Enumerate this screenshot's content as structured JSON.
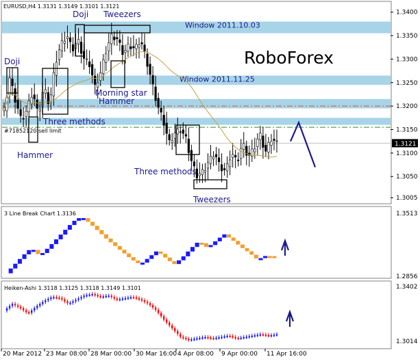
{
  "colors": {
    "window_zone": "#a8d4e8",
    "candle": "#000000",
    "bull": "#1a1aff",
    "bear_lb": "#f0a030",
    "bear_ha": "#ff0000",
    "logo": "#d2691e",
    "label": "#1a1a8c",
    "dash_red": "#e05020",
    "dash_green": "#2a8a2a",
    "ma": "#c8a040",
    "price_box": "#000000",
    "arrow": "#1a1a8c"
  },
  "main": {
    "title": "EURUSD,H4  1.3131 1.3149 1.3101 1.3121",
    "logo": "RoboForex",
    "current_price": "1.3121",
    "sell_limit": "#71852120 sell limit",
    "windows": [
      "Window 2011.10.03",
      "Window 2011.11.25"
    ],
    "pattern_labels": [
      "Doji",
      "Tweezers",
      "Doji",
      "Morning star",
      "Hammer",
      "Three methods",
      "Hammer",
      "Three methods",
      "Tweezers"
    ],
    "y_ticks": [
      "1.3400",
      "1.3350",
      "1.3300",
      "1.3250",
      "1.3200",
      "1.3150",
      "1.3100",
      "1.3050",
      "1.3005"
    ]
  },
  "line_break": {
    "title": "3 Line Break Chart 1.3136",
    "y_ticks": [
      "1.3513",
      "1.2856"
    ]
  },
  "heiken_ashi": {
    "title": "Heiken-Ashi 1.3118 1.3125 1.3118 1.3149 1.3101",
    "y_ticks": [
      "1.3402",
      "1.3014"
    ]
  },
  "x_ticks": [
    "20 Mar 2012",
    "23 Mar 08:00",
    "28 Mar 00:00",
    "30 Mar 16:00",
    "4 Apr 08:00",
    "9 Apr 00:00",
    "11 Apr 16:00"
  ],
  "chart_data": [
    {
      "type": "candlestick",
      "title": "EURUSD,H4  1.3131 1.3149 1.3101 1.3121",
      "symbol": "EURUSD",
      "timeframe": "H4",
      "last": {
        "open": 1.3131,
        "high": 1.3149,
        "low": 1.3101,
        "close": 1.3121
      },
      "ylim": [
        1.2995,
        1.342
      ],
      "x": [
        "20 Mar 2012",
        "23 Mar 08:00",
        "28 Mar 00:00",
        "30 Mar 16:00",
        "4 Apr 08:00",
        "9 Apr 00:00",
        "11 Apr 16:00"
      ],
      "close_path": [
        1.319,
        1.326,
        1.321,
        1.317,
        1.319,
        1.323,
        1.318,
        1.324,
        1.32,
        1.329,
        1.333,
        1.335,
        1.332,
        1.334,
        1.33,
        1.329,
        1.324,
        1.327,
        1.332,
        1.335,
        1.334,
        1.331,
        1.333,
        1.332,
        1.334,
        1.33,
        1.325,
        1.32,
        1.317,
        1.312,
        1.314,
        1.315,
        1.313,
        1.308,
        1.305,
        1.306,
        1.308,
        1.31,
        1.307,
        1.306,
        1.31,
        1.308,
        1.312,
        1.309,
        1.311,
        1.314,
        1.31,
        1.313,
        1.312
      ],
      "zones": [
        {
          "label": "Window 2011.10.03",
          "low": 1.3355,
          "high": 1.338
        },
        {
          "label": "Window 2011.11.25",
          "low": 1.3245,
          "high": 1.3265
        },
        {
          "label": "",
          "low": 1.3195,
          "high": 1.3215
        },
        {
          "label": "",
          "low": 1.316,
          "high": 1.3175
        }
      ],
      "levels": [
        {
          "value": 1.32,
          "style": "dash-dot",
          "color": "red"
        },
        {
          "value": 1.3155,
          "style": "dash-dot",
          "color": "green",
          "label": "#71852120 sell limit"
        }
      ],
      "current_price": 1.3121,
      "forecast": [
        1.3125,
        1.3165,
        1.307
      ],
      "annotations": [
        "Doji",
        "Tweezers",
        "Doji",
        "Morning star",
        "Hammer",
        "Three methods",
        "Hammer",
        "Three methods",
        "Tweezers"
      ]
    },
    {
      "type": "line-break",
      "title": "3 Line Break Chart 1.3136",
      "ylim": [
        1.2856,
        1.3513
      ],
      "path": [
        1.29,
        1.299,
        1.308,
        1.316,
        1.308,
        1.316,
        1.325,
        1.334,
        1.343,
        1.348,
        1.341,
        1.333,
        1.325,
        1.318,
        1.311,
        1.304,
        1.299,
        1.306,
        1.313,
        1.306,
        1.299,
        1.306,
        1.315,
        1.323,
        1.316,
        1.323,
        1.33,
        1.324,
        1.317,
        1.311,
        1.304,
        1.308,
        1.307
      ]
    },
    {
      "type": "heiken-ashi",
      "title": "Heiken-Ashi 1.3118 1.3125 1.3118 1.3149 1.3101",
      "ylim": [
        1.3,
        1.341
      ],
      "path": [
        1.325,
        1.33,
        1.327,
        1.323,
        1.328,
        1.332,
        1.335,
        1.334,
        1.33,
        1.333,
        1.336,
        1.337,
        1.335,
        1.336,
        1.333,
        1.334,
        1.335,
        1.333,
        1.33,
        1.325,
        1.318,
        1.312,
        1.306,
        1.304,
        1.305,
        1.306,
        1.305,
        1.306,
        1.307,
        1.305,
        1.306,
        1.307,
        1.308,
        1.307,
        1.308
      ]
    }
  ]
}
